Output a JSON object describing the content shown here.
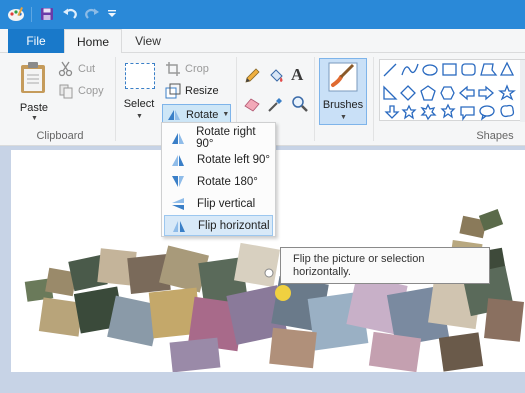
{
  "titlebar": {
    "icons": [
      "paint-app-icon",
      "save-icon",
      "undo-icon",
      "redo-icon",
      "customize-quick-access-icon"
    ]
  },
  "tabs": {
    "file": "File",
    "home": "Home",
    "view": "View"
  },
  "clipboard": {
    "paste": "Paste",
    "cut": "Cut",
    "copy": "Copy",
    "group_label": "Clipboard"
  },
  "image": {
    "select": "Select",
    "crop": "Crop",
    "resize": "Resize",
    "rotate": "Rotate",
    "group_label_partial": "I"
  },
  "tools": {
    "icons": [
      "pencil-icon",
      "fill-icon",
      "text-icon",
      "eraser-icon",
      "color-picker-icon",
      "magnifier-icon"
    ]
  },
  "brushes": {
    "label": "Brushes"
  },
  "shapes": {
    "group_label": "Shapes"
  },
  "rotate_menu": {
    "items": [
      {
        "label": "Rotate right 90°",
        "icon": "rotate-right-icon"
      },
      {
        "label": "Rotate left 90°",
        "icon": "rotate-left-icon"
      },
      {
        "label": "Rotate 180°",
        "icon": "rotate-180-icon"
      },
      {
        "label": "Flip vertical",
        "icon": "flip-vertical-icon"
      },
      {
        "label": "Flip horizontal",
        "icon": "flip-horizontal-icon"
      }
    ],
    "highlighted_index": 4
  },
  "tooltip": {
    "text": "Flip the picture or selection horizontally."
  },
  "colors": {
    "titlebar": "#2a89d8",
    "file_tab": "#1979ca",
    "ribbon": "#f5f6f7",
    "highlight": "#cde6f7",
    "canvas_bg": "#c7d3e6"
  }
}
